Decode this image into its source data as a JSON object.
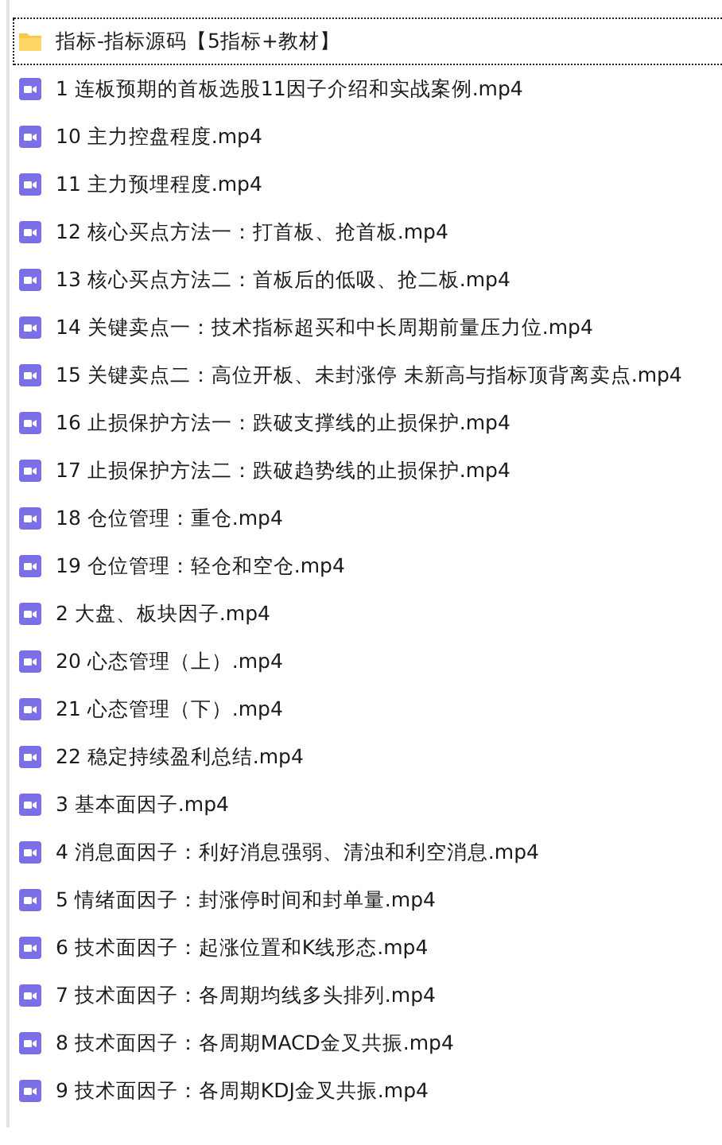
{
  "items": [
    {
      "kind": "folder",
      "name": "指标-指标源码【5指标+教材】",
      "focused": true
    },
    {
      "kind": "video",
      "name": "1  连板预期的首板选股11因子介绍和实战案例.mp4",
      "focused": false
    },
    {
      "kind": "video",
      "name": "10 主力控盘程度.mp4",
      "focused": false
    },
    {
      "kind": "video",
      "name": "11 主力预埋程度.mp4",
      "focused": false
    },
    {
      "kind": "video",
      "name": "12 核心买点方法一：打首板、抢首板.mp4",
      "focused": false
    },
    {
      "kind": "video",
      "name": "13 核心买点方法二：首板后的低吸、抢二板.mp4",
      "focused": false
    },
    {
      "kind": "video",
      "name": "14 关键卖点一：技术指标超买和中长周期前量压力位.mp4",
      "focused": false
    },
    {
      "kind": "video",
      "name": "15 关键卖点二：高位开板、未封涨停 未新高与指标顶背离卖点.mp4",
      "focused": false
    },
    {
      "kind": "video",
      "name": "16 止损保护方法一：跌破支撑线的止损保护.mp4",
      "focused": false
    },
    {
      "kind": "video",
      "name": "17 止损保护方法二：跌破趋势线的止损保护.mp4",
      "focused": false
    },
    {
      "kind": "video",
      "name": "18 仓位管理：重仓.mp4",
      "focused": false
    },
    {
      "kind": "video",
      "name": "19 仓位管理：轻仓和空仓.mp4",
      "focused": false
    },
    {
      "kind": "video",
      "name": "2  大盘、板块因子.mp4",
      "focused": false
    },
    {
      "kind": "video",
      "name": "20 心态管理（上）.mp4",
      "focused": false
    },
    {
      "kind": "video",
      "name": "21 心态管理（下）.mp4",
      "focused": false
    },
    {
      "kind": "video",
      "name": "22 稳定持续盈利总结.mp4",
      "focused": false
    },
    {
      "kind": "video",
      "name": "3  基本面因子.mp4",
      "focused": false
    },
    {
      "kind": "video",
      "name": "4  消息面因子：利好消息强弱、清浊和利空消息.mp4",
      "focused": false
    },
    {
      "kind": "video",
      "name": "5  情绪面因子：封涨停时间和封单量.mp4",
      "focused": false
    },
    {
      "kind": "video",
      "name": "6  技术面因子：起涨位置和K线形态.mp4",
      "focused": false
    },
    {
      "kind": "video",
      "name": "7  技术面因子：各周期均线多头排列.mp4",
      "focused": false
    },
    {
      "kind": "video",
      "name": "8  技术面因子：各周期MACD金叉共振.mp4",
      "focused": false
    },
    {
      "kind": "video",
      "name": "9  技术面因子：各周期KDJ金叉共振.mp4",
      "focused": false
    }
  ]
}
